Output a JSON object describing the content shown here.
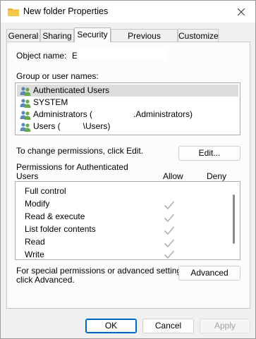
{
  "window": {
    "title": "New folder Properties"
  },
  "tabs": [
    {
      "label": "General"
    },
    {
      "label": "Sharing"
    },
    {
      "label": "Security"
    },
    {
      "label": "Previous Versions"
    },
    {
      "label": "Customize"
    }
  ],
  "active_tab": "Security",
  "object": {
    "label": "Object name:",
    "value": "E:\\"
  },
  "groups": {
    "label": "Group or user names:",
    "items": [
      {
        "name": "Authenticated Users"
      },
      {
        "name": "SYSTEM"
      },
      {
        "prefix": "Administrators (",
        "suffix": ".Administrators)"
      },
      {
        "prefix": "Users (",
        "suffix": "\\Users)"
      }
    ],
    "selected": "Authenticated Users"
  },
  "change_text": "To change permissions, click Edit.",
  "edit_button": "Edit...",
  "permissions": {
    "header_line1": "Permissions for Authenticated",
    "header_line2": "Users",
    "allow_label": "Allow",
    "deny_label": "Deny",
    "rows": [
      {
        "name": "Full control",
        "allow": false,
        "deny": false
      },
      {
        "name": "Modify",
        "allow": true,
        "deny": false
      },
      {
        "name": "Read & execute",
        "allow": true,
        "deny": false
      },
      {
        "name": "List folder contents",
        "allow": true,
        "deny": false
      },
      {
        "name": "Read",
        "allow": true,
        "deny": false
      },
      {
        "name": "Write",
        "allow": true,
        "deny": false
      }
    ]
  },
  "advanced": {
    "text_line1": "For special permissions or advanced settings,",
    "text_line2": "click Advanced.",
    "button": "Advanced"
  },
  "footer": {
    "ok": "OK",
    "cancel": "Cancel",
    "apply": "Apply"
  },
  "icons": {
    "title": "folder-icon",
    "close": "close-icon",
    "group": "users-group-icon",
    "check": "checkmark-icon"
  },
  "colors": {
    "accent": "#0067c0",
    "folder": "#f4c542",
    "check_inherited": "#b0b0b0",
    "selection": "#dcdcdc"
  }
}
